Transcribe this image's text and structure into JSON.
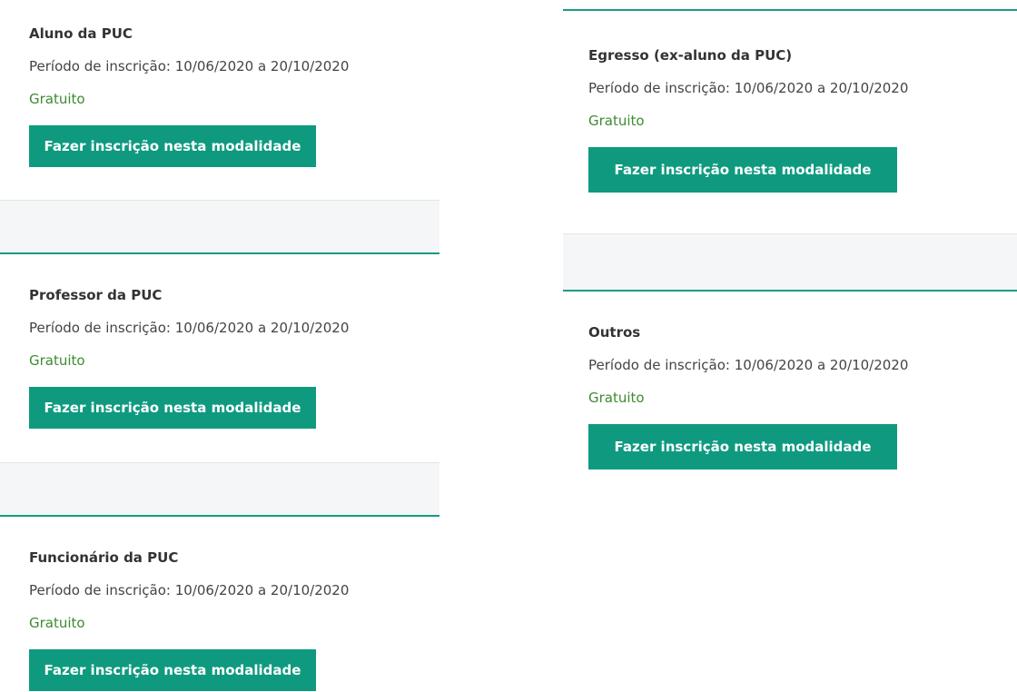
{
  "colors": {
    "accent": "#0f9a80",
    "price_green": "#3d8b2f",
    "divider_teal": "#1a9a85",
    "gap_bg": "#f5f6f7"
  },
  "left_column": [
    {
      "title": "Aluno da PUC",
      "period": "Período de inscrição: 10/06/2020 a 20/10/2020",
      "price": "Gratuito",
      "button": "Fazer inscrição nesta modalidade"
    },
    {
      "title": "Professor da PUC",
      "period": "Período de inscrição: 10/06/2020 a 20/10/2020",
      "price": "Gratuito",
      "button": "Fazer inscrição nesta modalidade"
    },
    {
      "title": "Funcionário da PUC",
      "period": "Período de inscrição: 10/06/2020 a 20/10/2020",
      "price": "Gratuito",
      "button": "Fazer inscrição nesta modalidade"
    }
  ],
  "right_column": [
    {
      "title": "Egresso (ex-aluno da PUC)",
      "period": "Período de inscrição: 10/06/2020 a 20/10/2020",
      "price": "Gratuito",
      "button": "Fazer inscrição nesta modalidade"
    },
    {
      "title": "Outros",
      "period": "Período de inscrição: 10/06/2020 a 20/10/2020",
      "price": "Gratuito",
      "button": "Fazer inscrição nesta modalidade"
    }
  ]
}
